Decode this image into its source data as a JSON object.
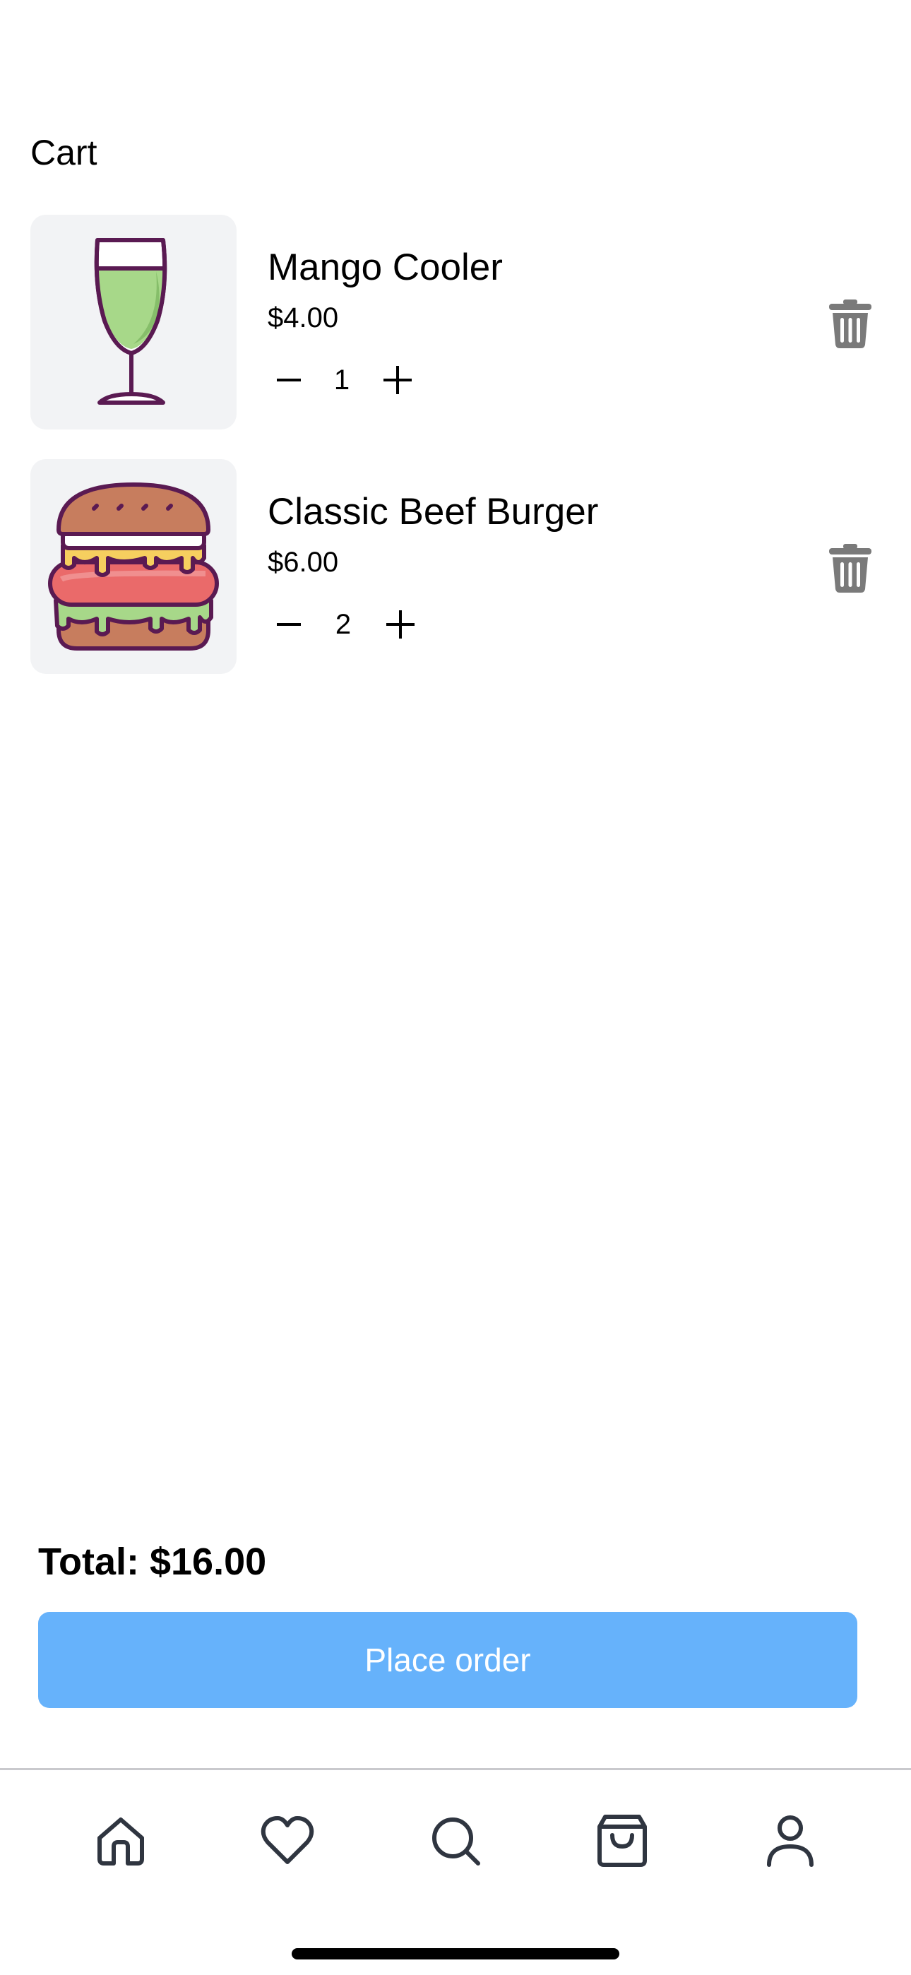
{
  "header": {
    "title": "Cart"
  },
  "cart": {
    "items": [
      {
        "name": "Mango Cooler",
        "price": "$4.00",
        "quantity": "1",
        "image_icon": "wine-glass-icon"
      },
      {
        "name": "Classic Beef Burger",
        "price": "$6.00",
        "quantity": "2",
        "image_icon": "burger-icon"
      }
    ],
    "total_label": "Total: $16.00",
    "place_order_label": "Place order"
  },
  "tabbar": {
    "items": [
      {
        "icon": "home-icon"
      },
      {
        "icon": "heart-icon"
      },
      {
        "icon": "search-icon"
      },
      {
        "icon": "shopping-bag-icon"
      },
      {
        "icon": "user-icon"
      }
    ]
  },
  "colors": {
    "primary_button": "#66b2fb",
    "thumbnail_bg": "#f2f3f5",
    "icon_gray": "#7a7a7a",
    "tab_icon": "#2f3540"
  }
}
